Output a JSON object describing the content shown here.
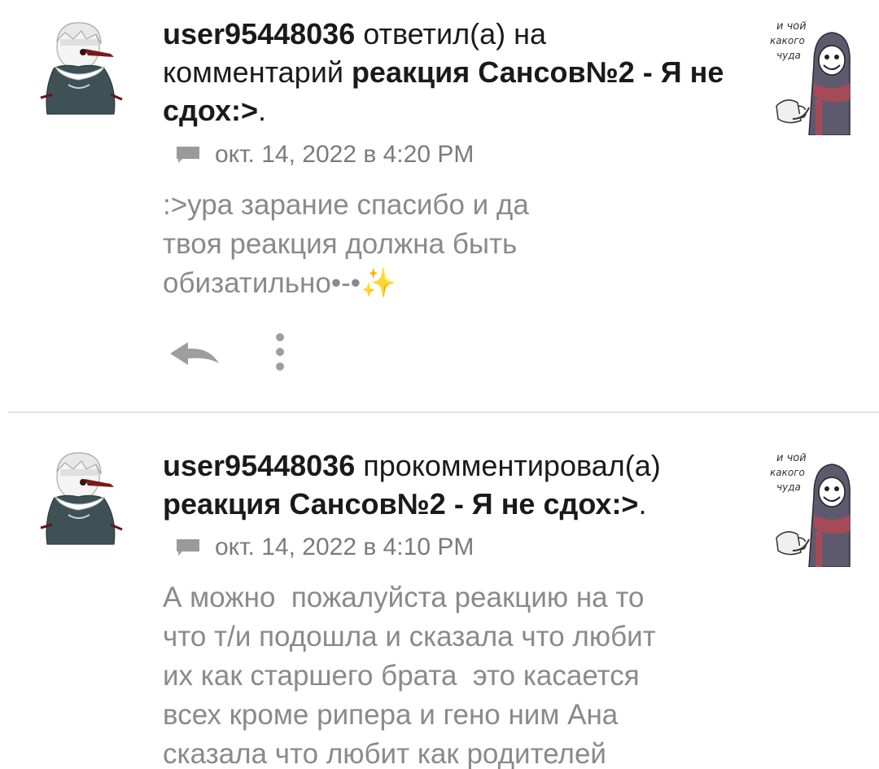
{
  "notifications": [
    {
      "user": "user95448036",
      "action": " ответил(а) на комментарий ",
      "post_title": "реакция Сансов№2 - Я не сдох:>",
      "trailing": ".",
      "timestamp": "окт. 14, 2022 в 4:20 PM",
      "text": ":>ура зарание спасибо и да\nтвоя реакция должна быть\nобизатильно•-•",
      "emoji": "✨",
      "actions": [
        "reply-icon",
        "more-icon"
      ]
    },
    {
      "user": "user95448036",
      "action": " прокомментировал(а) ",
      "post_title": "реакция Сансов№2 - Я не сдох:>",
      "trailing": ".",
      "timestamp": "окт. 14, 2022 в 4:10 PM",
      "text": "А можно  пожалуйста реакцию на то\nчто т/и подошла и сказала что любит\nих как старшего брата  это касается\nвсех кроме рипера и гено ним Ана\nсказала что любит как родителей"
    }
  ],
  "thumbnail_caption": {
    "line1": "и чой",
    "line2": "какого",
    "line3": "чуда"
  },
  "colors": {
    "text_primary": "#1a1a1a",
    "text_secondary": "#8a8a8a",
    "meta": "#7b7b7b",
    "divider": "#e4e4e4"
  }
}
